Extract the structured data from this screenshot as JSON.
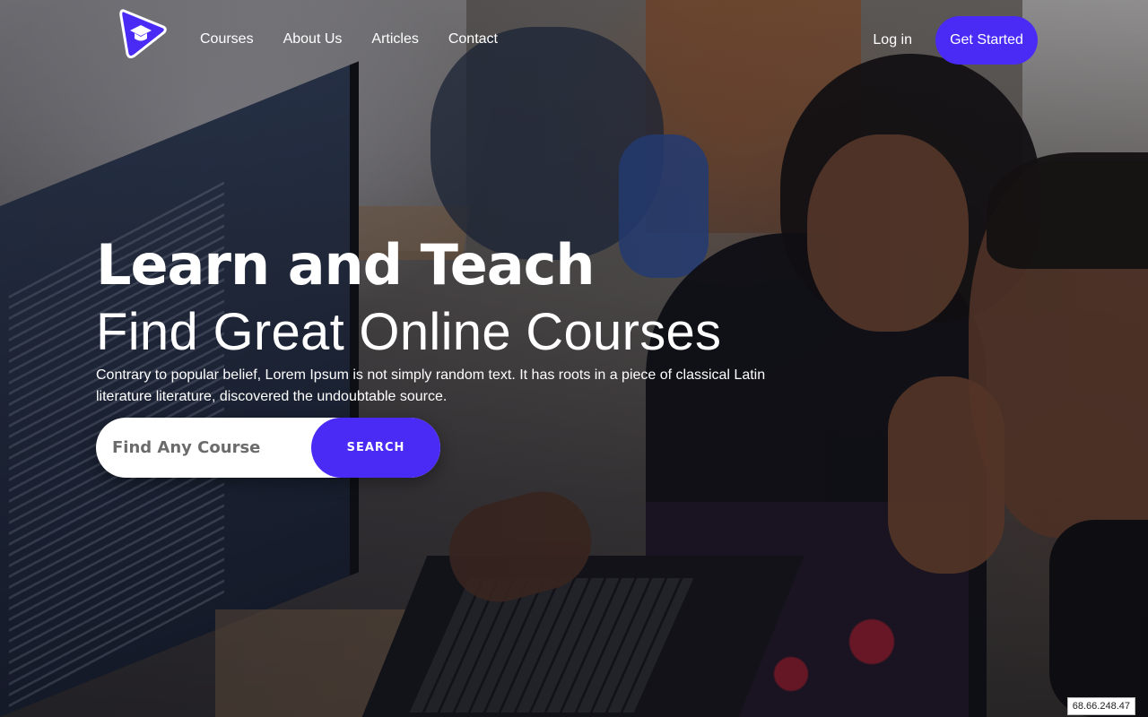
{
  "brand": {
    "logo_icon": "graduation-cap-icon",
    "accent_color": "#4a2bf5"
  },
  "nav": {
    "links": [
      {
        "label": "Courses"
      },
      {
        "label": "About Us"
      },
      {
        "label": "Articles"
      },
      {
        "label": "Contact"
      }
    ],
    "login_label": "Log in",
    "cta_label": "Get Started"
  },
  "hero": {
    "title": "Learn and Teach",
    "subtitle": "Find Great Online Courses",
    "description": "Contrary to popular belief, Lorem Ipsum is not simply random text. It has roots in a piece of classical Latin literature literature, discovered the undoubtable source."
  },
  "search": {
    "placeholder": "Find Any Course",
    "value": "",
    "button_label": "SEARCH"
  },
  "ip_badge": "68.66.248.47"
}
